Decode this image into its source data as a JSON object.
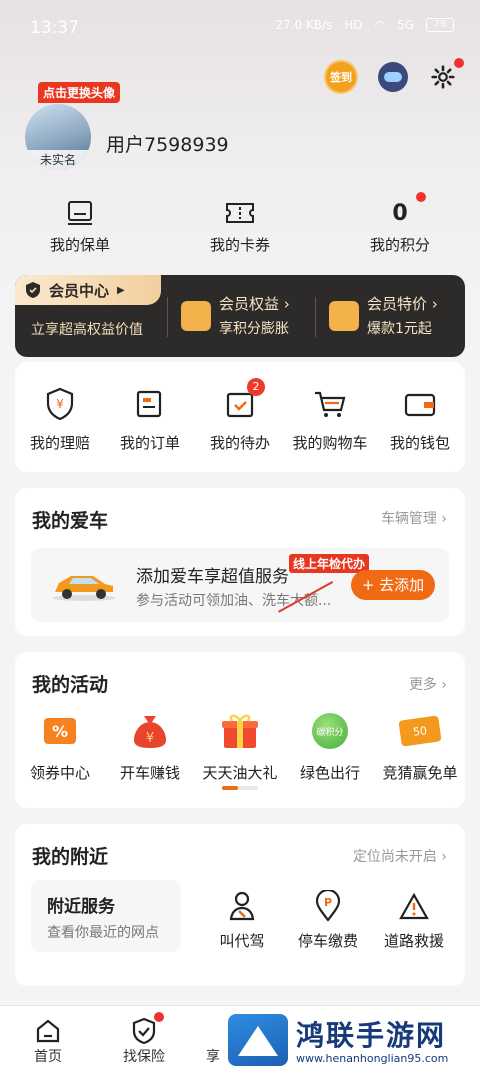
{
  "status_bar": {
    "time": "13:37",
    "net": "27.0 KB/s",
    "hd": "HD",
    "signal": "5G",
    "battery": "79"
  },
  "top_icons": {
    "signin_label": "签到"
  },
  "profile": {
    "avatar_tag": "点击更换头像",
    "avatar_label": "未实名",
    "username": "用户7598939"
  },
  "quick_links": [
    {
      "label": "我的保单"
    },
    {
      "label": "我的卡券"
    },
    {
      "label": "我的积分",
      "value": "0"
    }
  ],
  "member": {
    "tab": "会员中心",
    "sub": "立享超高权益价值",
    "benefit_title": "会员权益 ›",
    "benefit_sub": "享积分膨胀",
    "special_title": "会员特价 ›",
    "special_sub": "爆款1元起"
  },
  "services": [
    {
      "label": "我的理赔"
    },
    {
      "label": "我的订单"
    },
    {
      "label": "我的待办",
      "badge": "2"
    },
    {
      "label": "我的购物车"
    },
    {
      "label": "我的钱包"
    }
  ],
  "my_car": {
    "title": "我的爱车",
    "more": "车辆管理",
    "promo_tag": "线上年检代办",
    "main": "添加爱车享超值服务",
    "sub": "参与活动可领加油、洗车大额...",
    "add_button": "+ 去添加"
  },
  "activities": {
    "title": "我的活动",
    "more": "更多",
    "items": [
      {
        "label": "领券中心"
      },
      {
        "label": "开车赚钱"
      },
      {
        "label": "天天油大礼"
      },
      {
        "label": "绿色出行",
        "icon_text": "碳积分"
      },
      {
        "label": "竞猜赢免单",
        "icon_text": "50"
      }
    ]
  },
  "nearby": {
    "title": "我的附近",
    "more": "定位尚未开启",
    "box_title": "附近服务",
    "box_sub": "查看你最近的网点",
    "items": [
      {
        "label": "叫代驾"
      },
      {
        "label": "停车缴费"
      },
      {
        "label": "道路救援"
      }
    ]
  },
  "tabbar": [
    {
      "label": "首页"
    },
    {
      "label": "找保险"
    },
    {
      "label": "享"
    }
  ],
  "watermark": {
    "title": "鸿联手游网",
    "url": "www.henanhonglian95.com"
  },
  "colors": {
    "accent": "#f06a13",
    "member_bg": "#2d2a2a",
    "badge": "#ef3a2a"
  }
}
